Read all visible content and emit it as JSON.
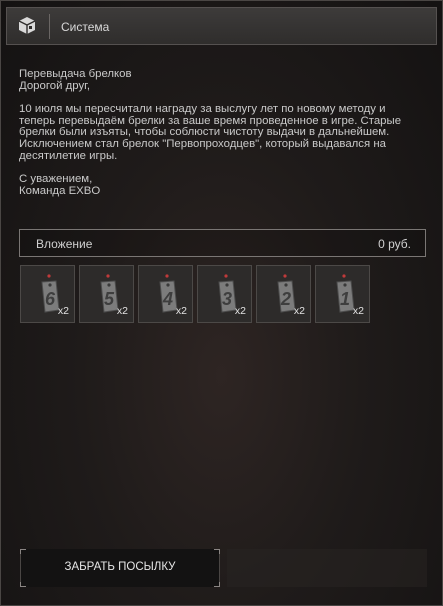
{
  "window": {
    "title": "Система",
    "icon": "package-box-icon"
  },
  "message": {
    "subject": "Перевыдача брелков",
    "greeting": "Дорогой друг,",
    "body": "10 июля мы пересчитали награду за выслугу лет по новому методу и\nтеперь перевыдаём брелки за ваше время проведенное в игре. Старые\nбрелки были изъяты, чтобы соблюсти чистоту выдачи в дальнейшем.\nИсключением стал брелок \"Первопроходцев\", который выдавался на\nдесятилетие игры.",
    "closing": "С уважением,",
    "signature": "Команда EXBO"
  },
  "attachment": {
    "label": "Вложение",
    "value": "0 руб."
  },
  "items": [
    {
      "numeral": "6",
      "qty": "x2",
      "icon": "keychain-tag-icon"
    },
    {
      "numeral": "5",
      "qty": "x2",
      "icon": "keychain-tag-icon"
    },
    {
      "numeral": "4",
      "qty": "x2",
      "icon": "keychain-tag-icon"
    },
    {
      "numeral": "3",
      "qty": "x2",
      "icon": "keychain-tag-icon"
    },
    {
      "numeral": "2",
      "qty": "x2",
      "icon": "keychain-tag-icon"
    },
    {
      "numeral": "1",
      "qty": "x2",
      "icon": "keychain-tag-icon"
    }
  ],
  "actions": {
    "claim_label": "ЗАБРАТЬ ПОСЫЛКУ"
  }
}
